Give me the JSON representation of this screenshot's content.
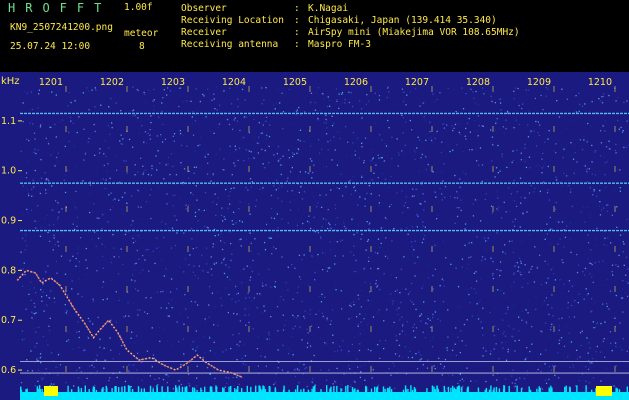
{
  "header": {
    "brand": "HROFFT",
    "version": "1.00f",
    "filename": "KN9_2507241200.png",
    "datetime": "25.07.24 12:00",
    "meteor_label": "meteor",
    "meteor_count": "8",
    "info": [
      {
        "key": "Observer",
        "value": "K.Nagai"
      },
      {
        "key": "Receiving Location",
        "value": "Chigasaki, Japan (139.414 35.340)"
      },
      {
        "key": "Receiver",
        "value": "AirSpy mini (Miakejima VOR 108.65MHz)"
      },
      {
        "key": "Receiving antenna",
        "value": "Maspro FM-3"
      }
    ]
  },
  "chart_data": {
    "type": "heatmap",
    "ylabel": "kHz",
    "x_ticks": [
      "1201",
      "1202",
      "1203",
      "1204",
      "1205",
      "1206",
      "1207",
      "1208",
      "1209",
      "1210"
    ],
    "y_ticks": [
      "1.1",
      "1.0",
      "0.9",
      "0.8",
      "0.7",
      "0.6"
    ],
    "ylim": [
      0.56,
      1.17
    ],
    "carrier_lines_khz": [
      1.115,
      0.975,
      0.88
    ],
    "ref_lines_khz": [
      0.617,
      0.594
    ],
    "trace_khz": [
      [
        1200.2,
        0.78
      ],
      [
        1200.35,
        0.8
      ],
      [
        1200.5,
        0.795
      ],
      [
        1200.6,
        0.775
      ],
      [
        1200.75,
        0.785
      ],
      [
        1200.9,
        0.77
      ],
      [
        1201.0,
        0.75
      ],
      [
        1201.15,
        0.72
      ],
      [
        1201.3,
        0.695
      ],
      [
        1201.45,
        0.665
      ],
      [
        1201.55,
        0.68
      ],
      [
        1201.7,
        0.7
      ],
      [
        1201.85,
        0.675
      ],
      [
        1202.0,
        0.64
      ],
      [
        1202.2,
        0.62
      ],
      [
        1202.4,
        0.625
      ],
      [
        1202.6,
        0.61
      ],
      [
        1202.8,
        0.6
      ],
      [
        1203.0,
        0.615
      ],
      [
        1203.15,
        0.63
      ],
      [
        1203.3,
        0.615
      ],
      [
        1203.5,
        0.6
      ],
      [
        1203.7,
        0.595
      ],
      [
        1203.9,
        0.585
      ]
    ],
    "colors": {
      "background": "#1a1a80",
      "carrier": "#5cd6ff",
      "text": "#ffe94a",
      "baseline": "#00e5ff",
      "peak": "#ffff00"
    }
  }
}
